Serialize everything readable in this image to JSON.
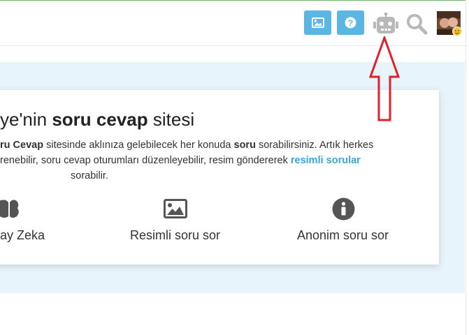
{
  "header": {
    "buttons": [
      {
        "name": "image-upload-button",
        "icon": "image-icon"
      },
      {
        "name": "help-button",
        "icon": "question-circle-icon"
      }
    ],
    "robot_icon": "robot-icon",
    "search_icon": "search-icon",
    "avatar": "user-avatar",
    "colors": {
      "button_bg": "#5bb6e3",
      "icon_gray": "#b8b8b8"
    }
  },
  "hero": {
    "title_part1": "ye'nin ",
    "title_bold": "soru cevap",
    "title_part2": " sitesi",
    "line1_bold1": "ru Cevap",
    "line1_text1": " sitesinde aklınıza gelebilecek her konuda ",
    "line1_bold2": "soru",
    "line1_text2": " sorabilirsiniz. Artık herkes",
    "line2_text": "renebilir, soru cevap oturumları düzenleyebilir, resim göndererek ",
    "line2_link": "resimli sorular",
    "line3_text": "sorabilir.",
    "colors": {
      "background": "#e8f4fb",
      "link": "#3aa7d6"
    }
  },
  "features": [
    {
      "label": "ay Zeka",
      "icon": "brain-icon"
    },
    {
      "label": "Resimli soru sor",
      "icon": "image-icon"
    },
    {
      "label": "Anonim soru sor",
      "icon": "info-circle-icon"
    }
  ],
  "annotation": {
    "arrow_color": "#e0212b",
    "icon": "red-arrow-up"
  }
}
